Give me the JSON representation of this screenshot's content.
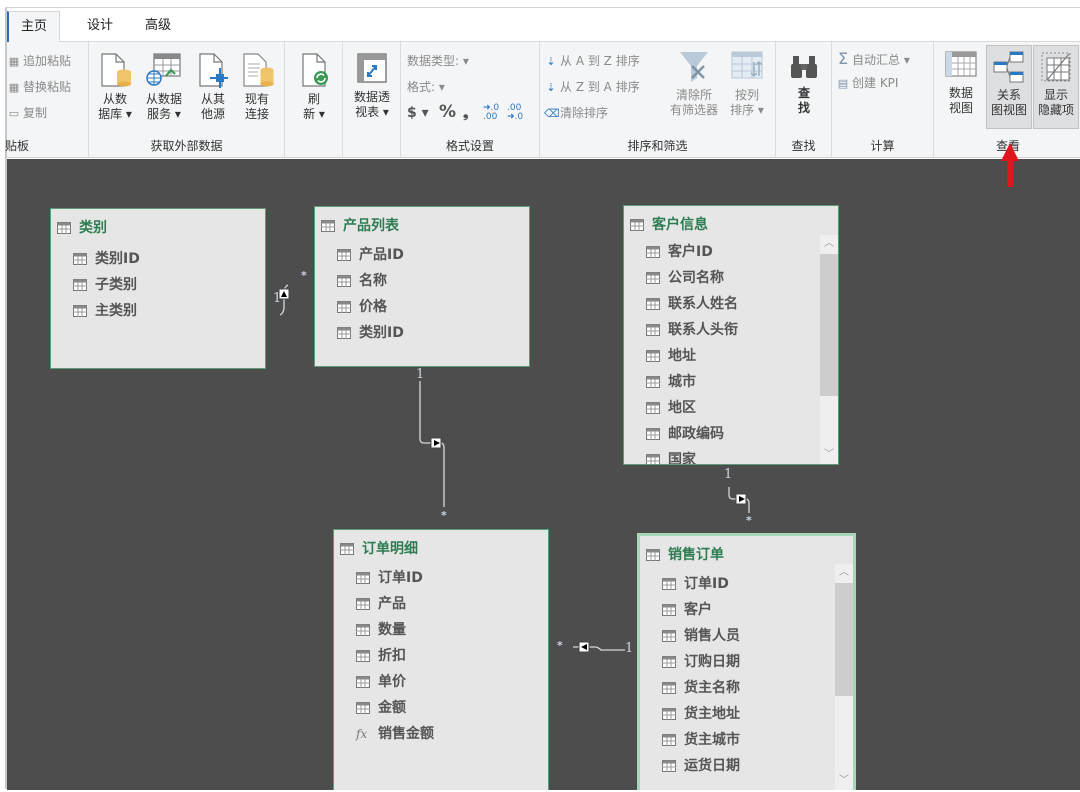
{
  "tabs": [
    {
      "label": "主页",
      "active": true
    },
    {
      "label": "设计",
      "active": false
    },
    {
      "label": "高级",
      "active": false
    }
  ],
  "ribbon": {
    "clipboard": {
      "label": "贴板",
      "items": [
        "追加粘贴",
        "替换粘贴",
        "复制"
      ]
    },
    "external": {
      "label": "获取外部数据",
      "buttons": [
        {
          "line1": "从数",
          "line2": "据库 ▾",
          "icon": "database-file-icon"
        },
        {
          "line1": "从数据",
          "line2": "服务 ▾",
          "icon": "data-service-icon"
        },
        {
          "line1": "从其",
          "line2": "他源",
          "icon": "other-source-icon"
        },
        {
          "line1": "现有",
          "line2": "连接",
          "icon": "existing-connection-icon"
        }
      ]
    },
    "refresh": {
      "line1": "刷",
      "line2": "新 ▾"
    },
    "pivot": {
      "line1": "数据透",
      "line2": "视表 ▾"
    },
    "format": {
      "label": "格式设置",
      "data_type": "数据类型: ▾",
      "format": "格式: ▾",
      "currency": "$ ▾",
      "percent": "%",
      "comma": "❟",
      "inc_decimal": "+.0 .00",
      "dec_decimal": ".00 +.0"
    },
    "sort": {
      "label": "排序和筛选",
      "az": "从 A 到 Z 排序",
      "za": "从 Z 到 A 排序",
      "clear_sort": "清除排序",
      "clear_filter_1": "清除所",
      "clear_filter_2": "有筛选器",
      "by_col_1": "按列",
      "by_col_2": "排序 ▾"
    },
    "find": {
      "label": "查找",
      "line1": "查",
      "line2": "找"
    },
    "calc": {
      "label": "计算",
      "autosum": "自动汇总 ▾",
      "kpi": "创建 KPI"
    },
    "view": {
      "label": "查看",
      "data_view_1": "数据",
      "data_view_2": "视图",
      "diagram_1": "关系",
      "diagram_2": "图视图",
      "hidden_1": "显示",
      "hidden_2": "隐藏项"
    }
  },
  "tables": [
    {
      "name": "类别",
      "columns": [
        "类别ID",
        "子类别",
        "主类别"
      ]
    },
    {
      "name": "产品列表",
      "columns": [
        "产品ID",
        "名称",
        "价格",
        "类别ID"
      ]
    },
    {
      "name": "客户信息",
      "columns": [
        "客户ID",
        "公司名称",
        "联系人姓名",
        "联系人头衔",
        "地址",
        "城市",
        "地区",
        "邮政编码",
        "国家"
      ]
    },
    {
      "name": "订单明细",
      "columns": [
        "订单ID",
        "产品",
        "数量",
        "折扣",
        "单价",
        "金额"
      ],
      "measures": [
        "销售金额"
      ]
    },
    {
      "name": "销售订单",
      "columns": [
        "订单ID",
        "客户",
        "销售人员",
        "订购日期",
        "货主名称",
        "货主地址",
        "货主城市",
        "运货日期"
      ]
    }
  ],
  "relationships": [
    {
      "from": "类别",
      "to": "产品列表",
      "one": "1",
      "many": "*"
    },
    {
      "from": "产品列表",
      "to": "订单明细",
      "one": "1",
      "many": "*"
    },
    {
      "from": "客户信息",
      "to": "销售订单",
      "one": "1",
      "many": "*"
    },
    {
      "from": "销售订单",
      "to": "订单明细",
      "one": "1",
      "many": "*"
    }
  ],
  "annotation": {
    "arrow_target": "关系图视图",
    "arrow_color": "#e0161d"
  },
  "colors": {
    "accent_green": "#2e7d52",
    "canvas": "#4d4d4d",
    "tab_accent": "#2b6cb8"
  }
}
